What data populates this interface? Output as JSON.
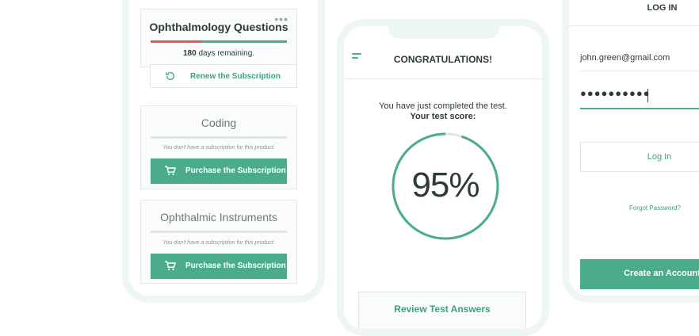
{
  "colors": {
    "accent": "#4aac8a",
    "danger": "#e0584e",
    "track": "#e1e5e5"
  },
  "subscriptions": {
    "active": {
      "title": "Ophthalmology Questions",
      "days_number": "180",
      "days_suffix": "days remaining.",
      "progress": 0.37,
      "renew_label": "Renew the Subscription",
      "menu_icon": "more-dots-icon",
      "renew_icon": "refresh-icon"
    },
    "coding": {
      "title": "Coding",
      "notice": "You don't have a subscription for this product.",
      "button_label": "Purchase the Subscription",
      "button_icon": "cart-icon"
    },
    "instruments": {
      "title": "Ophthalmic Instruments",
      "notice": "You don't have a subscription for this product.",
      "button_label": "Purchase the Subscription",
      "button_icon": "cart-icon"
    }
  },
  "result": {
    "header_title": "CONGRATULATIONS!",
    "completed_text": "You have just completed the test.",
    "score_label": "Your test score:",
    "score_text": "95%",
    "score_value": 0.95,
    "review_label": "Review Test Answers",
    "menu_icon": "hamburger-icon"
  },
  "login": {
    "title": "LOG IN",
    "email_value": "john.green@gmail.com",
    "password_mask": "●●●●●●●●●●",
    "login_button": "Log In",
    "forgot_link": "Forgot Password?",
    "create_button": "Create an Account"
  }
}
